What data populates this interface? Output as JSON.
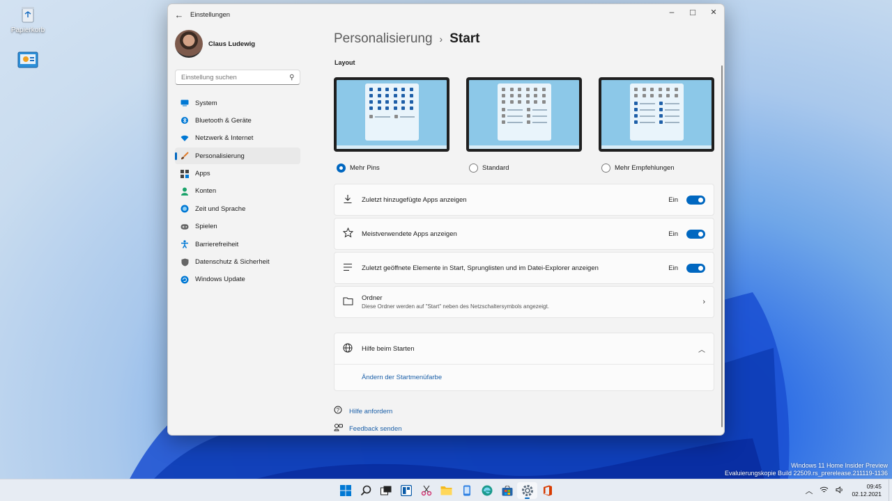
{
  "desktop": {
    "icons": [
      {
        "label": "Papierkorb",
        "icon": "recycle-bin-icon"
      },
      {
        "label": "",
        "icon": "control-panel-icon"
      }
    ],
    "watermark_line1": "Windows 11 Home Insider Preview",
    "watermark_line2": "Evaluierungskopie Build 22509.rs_prerelease.211119-1136"
  },
  "window": {
    "title": "Einstellungen",
    "minimize": "–",
    "maximize": "□",
    "close": "✕"
  },
  "sidebar": {
    "user_name": "Claus Ludewig",
    "search_placeholder": "Einstellung suchen",
    "items": [
      {
        "label": "System",
        "icon": "system-icon",
        "color": "#0078d4"
      },
      {
        "label": "Bluetooth & Geräte",
        "icon": "bluetooth-icon",
        "color": "#0078d4"
      },
      {
        "label": "Netzwerk & Internet",
        "icon": "wifi-icon",
        "color": "#0078d4"
      },
      {
        "label": "Personalisierung",
        "icon": "brush-icon",
        "color": "#e07a28",
        "active": true
      },
      {
        "label": "Apps",
        "icon": "apps-icon",
        "color": "#444444"
      },
      {
        "label": "Konten",
        "icon": "account-icon",
        "color": "#1aa36a"
      },
      {
        "label": "Zeit und Sprache",
        "icon": "globe-clock-icon",
        "color": "#0078d4"
      },
      {
        "label": "Spielen",
        "icon": "gamepad-icon",
        "color": "#666666"
      },
      {
        "label": "Barrierefreiheit",
        "icon": "accessibility-icon",
        "color": "#0078d4"
      },
      {
        "label": "Datenschutz & Sicherheit",
        "icon": "shield-icon",
        "color": "#666666"
      },
      {
        "label": "Windows Update",
        "icon": "update-icon",
        "color": "#0078d4"
      }
    ]
  },
  "main": {
    "breadcrumb_parent": "Personalisierung",
    "breadcrumb_sep": "›",
    "breadcrumb_current": "Start",
    "layout_label": "Layout",
    "layout_options": [
      {
        "label": "Mehr Pins",
        "selected": true
      },
      {
        "label": "Standard",
        "selected": false
      },
      {
        "label": "Mehr Empfehlungen",
        "selected": false
      }
    ],
    "toggles": [
      {
        "label": "Zuletzt hinzugefügte Apps anzeigen",
        "state": "Ein",
        "on": true,
        "icon": "download-icon"
      },
      {
        "label": "Meistverwendete Apps anzeigen",
        "state": "Ein",
        "on": true,
        "icon": "star-icon"
      },
      {
        "label": "Zuletzt geöffnete Elemente in Start, Sprunglisten und im Datei-Explorer anzeigen",
        "state": "Ein",
        "on": true,
        "icon": "list-icon"
      }
    ],
    "folders": {
      "title": "Ordner",
      "subtitle": "Diese Ordner werden auf \"Start\" neben des Netzschaltersymbols angezeigt."
    },
    "help": {
      "title": "Hilfe beim Starten",
      "link": "Ändern der Startmenüfarbe"
    },
    "footer_links": [
      {
        "label": "Hilfe anfordern",
        "icon": "help-icon"
      },
      {
        "label": "Feedback senden",
        "icon": "feedback-icon"
      }
    ]
  },
  "taskbar": {
    "apps": [
      {
        "name": "start-button",
        "color": "#0078d4"
      },
      {
        "name": "search-button",
        "color": "#222222"
      },
      {
        "name": "task-view-button",
        "color": "#222222"
      },
      {
        "name": "widgets-button",
        "color": "#0a5ba8"
      },
      {
        "name": "snipping-tool-button",
        "color": "#d0306e"
      },
      {
        "name": "file-explorer-button",
        "color": "#f3b81c"
      },
      {
        "name": "phone-link-button",
        "color": "#2a7de1"
      },
      {
        "name": "edge-button",
        "color": "#1b9a8c"
      },
      {
        "name": "store-button",
        "color": "#2364aa"
      },
      {
        "name": "settings-button",
        "color": "#5a6a7a",
        "active": true
      },
      {
        "name": "office-button",
        "color": "#d83b01"
      }
    ],
    "time": "09:45",
    "date": "02.12.2021"
  }
}
